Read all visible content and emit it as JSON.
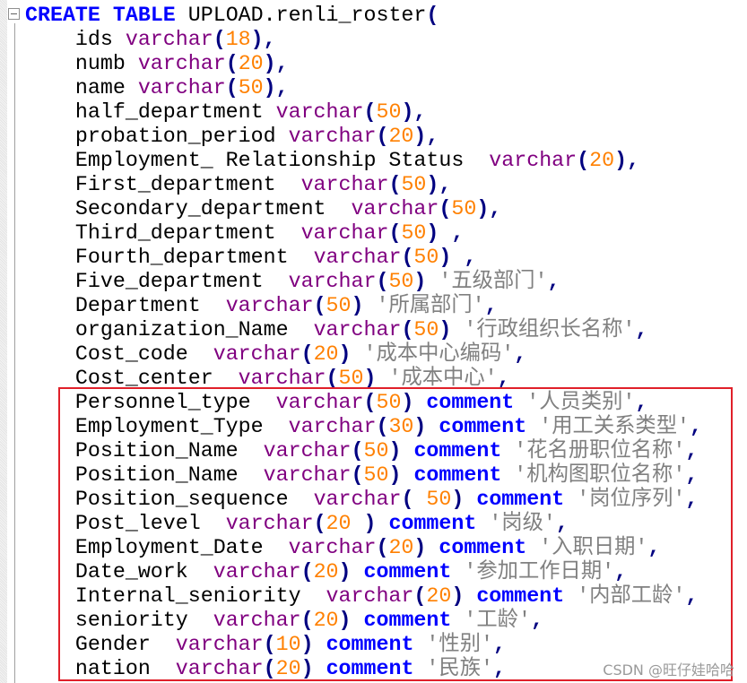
{
  "editor": {
    "colors": {
      "keyword": "#0000ff",
      "type": "#800080",
      "number": "#ff8000",
      "operator": "#000080",
      "string": "#808080",
      "highlight_box": "#e0202a"
    },
    "lines": [
      [
        [
          "kw",
          "CREATE"
        ],
        [
          "id",
          " "
        ],
        [
          "kw",
          "TABLE"
        ],
        [
          "id",
          " UPLOAD.renli_roster"
        ],
        [
          "op",
          "("
        ]
      ],
      [
        [
          "id",
          "    ids "
        ],
        [
          "ty",
          "varchar"
        ],
        [
          "op",
          "("
        ],
        [
          "num",
          "18"
        ],
        [
          "op",
          "),"
        ]
      ],
      [
        [
          "id",
          "    numb "
        ],
        [
          "ty",
          "varchar"
        ],
        [
          "op",
          "("
        ],
        [
          "num",
          "20"
        ],
        [
          "op",
          "),"
        ]
      ],
      [
        [
          "id",
          "    name "
        ],
        [
          "ty",
          "varchar"
        ],
        [
          "op",
          "("
        ],
        [
          "num",
          "50"
        ],
        [
          "op",
          "),"
        ]
      ],
      [
        [
          "id",
          "    half_department "
        ],
        [
          "ty",
          "varchar"
        ],
        [
          "op",
          "("
        ],
        [
          "num",
          "50"
        ],
        [
          "op",
          "),"
        ]
      ],
      [
        [
          "id",
          "    probation_period "
        ],
        [
          "ty",
          "varchar"
        ],
        [
          "op",
          "("
        ],
        [
          "num",
          "20"
        ],
        [
          "op",
          "),"
        ]
      ],
      [
        [
          "id",
          "    Employment_ Relationship Status  "
        ],
        [
          "ty",
          "varchar"
        ],
        [
          "op",
          "("
        ],
        [
          "num",
          "20"
        ],
        [
          "op",
          "),"
        ]
      ],
      [
        [
          "id",
          "    First_department  "
        ],
        [
          "ty",
          "varchar"
        ],
        [
          "op",
          "("
        ],
        [
          "num",
          "50"
        ],
        [
          "op",
          "),"
        ]
      ],
      [
        [
          "id",
          "    Secondary_department  "
        ],
        [
          "ty",
          "varchar"
        ],
        [
          "op",
          "("
        ],
        [
          "num",
          "50"
        ],
        [
          "op",
          "),"
        ]
      ],
      [
        [
          "id",
          "    Third_department  "
        ],
        [
          "ty",
          "varchar"
        ],
        [
          "op",
          "("
        ],
        [
          "num",
          "50"
        ],
        [
          "op",
          ")"
        ],
        [
          "id",
          " "
        ],
        [
          "op",
          ","
        ]
      ],
      [
        [
          "id",
          "    Fourth_department  "
        ],
        [
          "ty",
          "varchar"
        ],
        [
          "op",
          "("
        ],
        [
          "num",
          "50"
        ],
        [
          "op",
          ")"
        ],
        [
          "id",
          " "
        ],
        [
          "op",
          ","
        ]
      ],
      [
        [
          "id",
          "    Five_department  "
        ],
        [
          "ty",
          "varchar"
        ],
        [
          "op",
          "("
        ],
        [
          "num",
          "50"
        ],
        [
          "op",
          ")"
        ],
        [
          "id",
          " "
        ],
        [
          "str",
          "'五级部门'"
        ],
        [
          "op",
          ","
        ]
      ],
      [
        [
          "id",
          "    Department  "
        ],
        [
          "ty",
          "varchar"
        ],
        [
          "op",
          "("
        ],
        [
          "num",
          "50"
        ],
        [
          "op",
          ")"
        ],
        [
          "id",
          " "
        ],
        [
          "str",
          "'所属部门'"
        ],
        [
          "op",
          ","
        ]
      ],
      [
        [
          "id",
          "    organization_Name  "
        ],
        [
          "ty",
          "varchar"
        ],
        [
          "op",
          "("
        ],
        [
          "num",
          "50"
        ],
        [
          "op",
          ")"
        ],
        [
          "id",
          " "
        ],
        [
          "str",
          "'行政组织长名称'"
        ],
        [
          "op",
          ","
        ]
      ],
      [
        [
          "id",
          "    Cost_code  "
        ],
        [
          "ty",
          "varchar"
        ],
        [
          "op",
          "("
        ],
        [
          "num",
          "20"
        ],
        [
          "op",
          ")"
        ],
        [
          "id",
          " "
        ],
        [
          "str",
          "'成本中心编码'"
        ],
        [
          "op",
          ","
        ]
      ],
      [
        [
          "id",
          "    Cost_center  "
        ],
        [
          "ty",
          "varchar"
        ],
        [
          "op",
          "("
        ],
        [
          "num",
          "50"
        ],
        [
          "op",
          ")"
        ],
        [
          "id",
          " "
        ],
        [
          "str",
          "'成本中心'"
        ],
        [
          "op",
          ","
        ]
      ],
      [
        [
          "id",
          "    Personnel_type  "
        ],
        [
          "ty",
          "varchar"
        ],
        [
          "op",
          "("
        ],
        [
          "num",
          "50"
        ],
        [
          "op",
          ")"
        ],
        [
          "id",
          " "
        ],
        [
          "kw",
          "comment"
        ],
        [
          "id",
          " "
        ],
        [
          "str",
          "'人员类别'"
        ],
        [
          "op",
          ","
        ]
      ],
      [
        [
          "id",
          "    Employment_Type  "
        ],
        [
          "ty",
          "varchar"
        ],
        [
          "op",
          "("
        ],
        [
          "num",
          "30"
        ],
        [
          "op",
          ")"
        ],
        [
          "id",
          " "
        ],
        [
          "kw",
          "comment"
        ],
        [
          "id",
          " "
        ],
        [
          "str",
          "'用工关系类型'"
        ],
        [
          "op",
          ","
        ]
      ],
      [
        [
          "id",
          "    Position_Name  "
        ],
        [
          "ty",
          "varchar"
        ],
        [
          "op",
          "("
        ],
        [
          "num",
          "50"
        ],
        [
          "op",
          ")"
        ],
        [
          "id",
          " "
        ],
        [
          "kw",
          "comment"
        ],
        [
          "id",
          " "
        ],
        [
          "str",
          "'花名册职位名称'"
        ],
        [
          "op",
          ","
        ]
      ],
      [
        [
          "id",
          "    Position_Name  "
        ],
        [
          "ty",
          "varchar"
        ],
        [
          "op",
          "("
        ],
        [
          "num",
          "50"
        ],
        [
          "op",
          ")"
        ],
        [
          "id",
          " "
        ],
        [
          "kw",
          "comment"
        ],
        [
          "id",
          " "
        ],
        [
          "str",
          "'机构图职位名称'"
        ],
        [
          "op",
          ","
        ]
      ],
      [
        [
          "id",
          "    Position_sequence  "
        ],
        [
          "ty",
          "varchar"
        ],
        [
          "op",
          "("
        ],
        [
          "id",
          " "
        ],
        [
          "num",
          "50"
        ],
        [
          "op",
          ")"
        ],
        [
          "id",
          " "
        ],
        [
          "kw",
          "comment"
        ],
        [
          "id",
          " "
        ],
        [
          "str",
          "'岗位序列'"
        ],
        [
          "op",
          ","
        ]
      ],
      [
        [
          "id",
          "    Post_level  "
        ],
        [
          "ty",
          "varchar"
        ],
        [
          "op",
          "("
        ],
        [
          "num",
          "20"
        ],
        [
          "id",
          " "
        ],
        [
          "op",
          ")"
        ],
        [
          "id",
          " "
        ],
        [
          "kw",
          "comment"
        ],
        [
          "id",
          " "
        ],
        [
          "str",
          "'岗级'"
        ],
        [
          "op",
          ","
        ]
      ],
      [
        [
          "id",
          "    Employment_Date  "
        ],
        [
          "ty",
          "varchar"
        ],
        [
          "op",
          "("
        ],
        [
          "num",
          "20"
        ],
        [
          "op",
          ")"
        ],
        [
          "id",
          " "
        ],
        [
          "kw",
          "comment"
        ],
        [
          "id",
          " "
        ],
        [
          "str",
          "'入职日期'"
        ],
        [
          "op",
          ","
        ]
      ],
      [
        [
          "id",
          "    Date_work  "
        ],
        [
          "ty",
          "varchar"
        ],
        [
          "op",
          "("
        ],
        [
          "num",
          "20"
        ],
        [
          "op",
          ")"
        ],
        [
          "id",
          " "
        ],
        [
          "kw",
          "comment"
        ],
        [
          "id",
          " "
        ],
        [
          "str",
          "'参加工作日期'"
        ],
        [
          "op",
          ","
        ]
      ],
      [
        [
          "id",
          "    Internal_seniority  "
        ],
        [
          "ty",
          "varchar"
        ],
        [
          "op",
          "("
        ],
        [
          "num",
          "20"
        ],
        [
          "op",
          ")"
        ],
        [
          "id",
          " "
        ],
        [
          "kw",
          "comment"
        ],
        [
          "id",
          " "
        ],
        [
          "str",
          "'内部工龄'"
        ],
        [
          "op",
          ","
        ]
      ],
      [
        [
          "id",
          "    seniority  "
        ],
        [
          "ty",
          "varchar"
        ],
        [
          "op",
          "("
        ],
        [
          "num",
          "20"
        ],
        [
          "op",
          ")"
        ],
        [
          "id",
          " "
        ],
        [
          "kw",
          "comment"
        ],
        [
          "id",
          " "
        ],
        [
          "str",
          "'工龄'"
        ],
        [
          "op",
          ","
        ]
      ],
      [
        [
          "id",
          "    Gender  "
        ],
        [
          "ty",
          "varchar"
        ],
        [
          "op",
          "("
        ],
        [
          "num",
          "10"
        ],
        [
          "op",
          ")"
        ],
        [
          "id",
          " "
        ],
        [
          "kw",
          "comment"
        ],
        [
          "id",
          " "
        ],
        [
          "str",
          "'性别'"
        ],
        [
          "op",
          ","
        ]
      ],
      [
        [
          "id",
          "    nation  "
        ],
        [
          "ty",
          "varchar"
        ],
        [
          "op",
          "("
        ],
        [
          "num",
          "20"
        ],
        [
          "op",
          ")"
        ],
        [
          "id",
          " "
        ],
        [
          "kw",
          "comment"
        ],
        [
          "id",
          " "
        ],
        [
          "str",
          "'民族'"
        ],
        [
          "op",
          ","
        ]
      ]
    ]
  },
  "watermark": "CSDN @旺仔娃哈哈"
}
